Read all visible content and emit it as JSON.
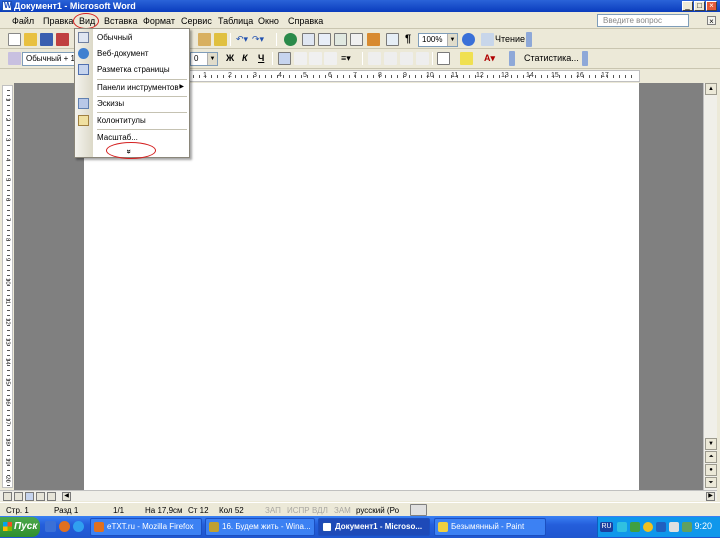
{
  "window": {
    "title": "Документ1 - Microsoft Word"
  },
  "menubar": {
    "items": [
      "Файл",
      "Правка",
      "Вид",
      "Вставка",
      "Формат",
      "Сервис",
      "Таблица",
      "Окно",
      "Справка"
    ],
    "ask_placeholder": "Введите вопрос"
  },
  "toolbar1": {
    "zoom": "100%",
    "read_label": "Чтение"
  },
  "toolbar2": {
    "style": "Обычный + 1",
    "size": "0",
    "stats_label": "Статистика..."
  },
  "view_menu": {
    "items": [
      {
        "label": "Обычный",
        "icon": "normal-view-icon"
      },
      {
        "label": "Веб-документ",
        "icon": "web-view-icon"
      },
      {
        "label": "Разметка страницы",
        "icon": "print-layout-icon"
      },
      {
        "label": "Панели инструментов",
        "icon": "",
        "submenu": true
      },
      {
        "label": "Эскизы",
        "icon": "thumbnails-icon"
      },
      {
        "label": "Колонтитулы",
        "icon": "header-footer-icon"
      },
      {
        "label": "Масштаб...",
        "icon": ""
      }
    ],
    "expand_glyph": "»"
  },
  "ruler": {
    "labels": [
      "1",
      "2",
      "3",
      "4",
      "5",
      "6",
      "7",
      "8",
      "9",
      "10",
      "11",
      "12",
      "13",
      "14",
      "15",
      "16",
      "17"
    ]
  },
  "vruler": {
    "labels": [
      "1",
      "2",
      "3",
      "4",
      "5",
      "6",
      "7",
      "8",
      "9",
      "10",
      "11",
      "12",
      "13",
      "14",
      "15",
      "16",
      "17",
      "18",
      "19",
      "20"
    ]
  },
  "statusbar": {
    "page": "Стр. 1",
    "section": "Разд 1",
    "pages": "1/1",
    "position": "На 17,9см",
    "line": "Ст 12",
    "column": "Кол 52",
    "rec": "ЗАП",
    "trk": "ИСПР",
    "ext": "ВДЛ",
    "ovr": "ЗАМ",
    "language": "русский (Ро"
  },
  "taskbar": {
    "start_label": "Пуск",
    "tasks": [
      {
        "label": "eTXT.ru - Mozilla Firefox",
        "active": false
      },
      {
        "label": "16. Будем жить - Wina...",
        "active": false
      },
      {
        "label": "Документ1 - Microso...",
        "active": true
      },
      {
        "label": "Безымянный - Paint",
        "active": false
      }
    ],
    "lang": "RU",
    "clock": "9:20"
  },
  "colors": {
    "titlebar": "#0a3cbd",
    "taskbar": "#245edb",
    "highlight_circle": "#d42020"
  }
}
